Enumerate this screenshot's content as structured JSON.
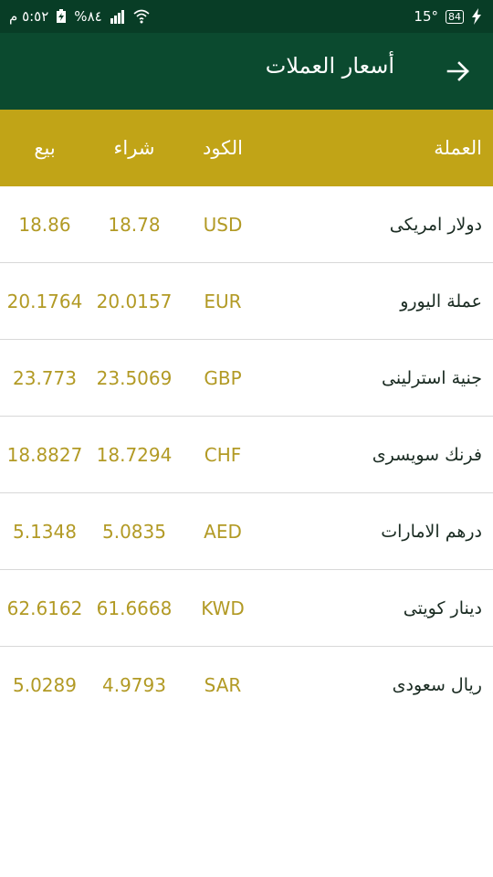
{
  "status_bar": {
    "time": "٥:٥٢ م",
    "battery_percent": "%٨٤",
    "temperature": "15°",
    "battery_badge": "84"
  },
  "app_bar": {
    "title": "أسعار العملات",
    "back_icon": "arrow-right-icon"
  },
  "table": {
    "headers": {
      "currency": "العملة",
      "code": "الكود",
      "buy": "شراء",
      "sell": "بيع"
    },
    "rows": [
      {
        "name": "دولار امريكى",
        "code": "USD",
        "buy": "18.78",
        "sell": "18.86"
      },
      {
        "name": "عملة اليورو",
        "code": "EUR",
        "buy": "20.0157",
        "sell": "20.1764"
      },
      {
        "name": "جنية استرلينى",
        "code": "GBP",
        "buy": "23.5069",
        "sell": "23.773"
      },
      {
        "name": "فرنك سويسرى",
        "code": "CHF",
        "buy": "18.7294",
        "sell": "18.8827"
      },
      {
        "name": "درهم الامارات",
        "code": "AED",
        "buy": "5.0835",
        "sell": "5.1348"
      },
      {
        "name": "دينار كويتى",
        "code": "KWD",
        "buy": "61.6668",
        "sell": "62.6162"
      },
      {
        "name": "ريال سعودى",
        "code": "SAR",
        "buy": "4.9793",
        "sell": "5.0289"
      }
    ]
  },
  "colors": {
    "status_bar": "#083d26",
    "app_bar": "#0b4a2f",
    "header": "#c1a417",
    "value_text": "#b29a25"
  }
}
